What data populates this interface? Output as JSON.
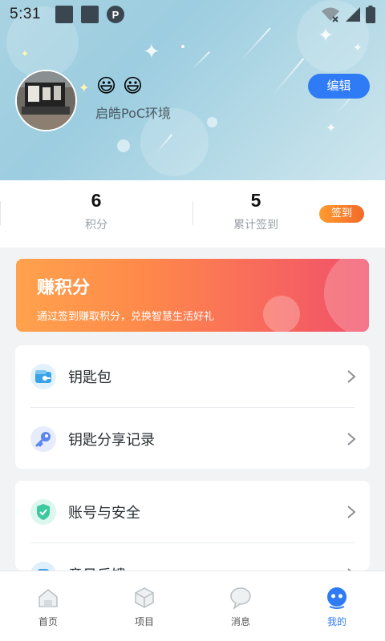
{
  "status_bar": {
    "time": "5:31",
    "notification_icons": [
      "square-app-icon",
      "square-app-icon",
      "app-badge-icon"
    ],
    "right_icons": [
      "wifi-off-icon",
      "signal-icon",
      "battery-icon"
    ]
  },
  "profile": {
    "avatar": "avatar-photo",
    "emojis": [
      "😃",
      "😃"
    ],
    "nickname": "启皓PoC环境",
    "edit_label": "编辑"
  },
  "stats": {
    "points_value": "6",
    "points_label": "积分",
    "checkins_value": "5",
    "checkins_label": "累计签到",
    "checkin_button": "签到"
  },
  "banner": {
    "title": "赚积分",
    "subtitle": "通过签到赚取积分，兑换智慧生活好礼"
  },
  "menu_group_1": [
    {
      "label": "钥匙包",
      "icon": "key-wallet-icon"
    },
    {
      "label": "钥匙分享记录",
      "icon": "key-icon"
    }
  ],
  "menu_group_2": [
    {
      "label": "账号与安全",
      "icon": "shield-icon"
    },
    {
      "label": "意见反馈",
      "icon": "feedback-icon"
    }
  ],
  "tabs": [
    {
      "label": "首页",
      "icon": "home-icon",
      "active": false
    },
    {
      "label": "项目",
      "icon": "cube-icon",
      "active": false
    },
    {
      "label": "消息",
      "icon": "chat-bubble-icon",
      "active": false
    },
    {
      "label": "我的",
      "icon": "profile-face-icon",
      "active": true
    }
  ],
  "colors": {
    "accent": "#2f7bf5",
    "checkin_gradient": [
      "#ff9b2f",
      "#f26a2a"
    ],
    "banner_gradient": [
      "#ffa24d",
      "#f0506a"
    ]
  }
}
